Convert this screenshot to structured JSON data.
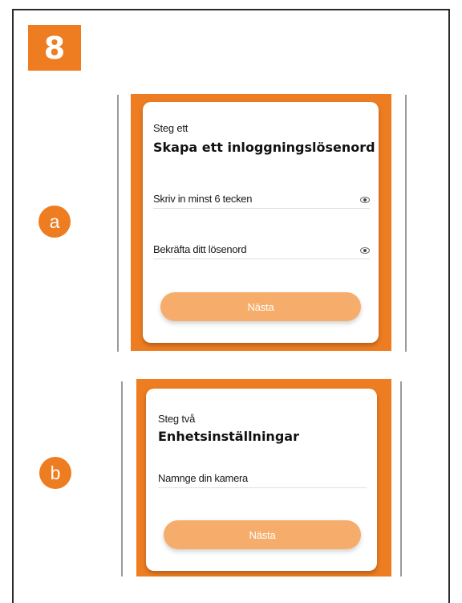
{
  "step_number": "8",
  "panels": [
    {
      "marker": "a",
      "step_label": "Steg ett",
      "title": "Skapa ett inloggningslösenord",
      "fields": [
        {
          "label": "Skriv in minst 6 tecken",
          "icon": "eye-icon"
        },
        {
          "label": "Bekräfta ditt lösenord",
          "icon": "eye-icon"
        }
      ],
      "button_label": "Nästa"
    },
    {
      "marker": "b",
      "step_label": "Steg två",
      "title": "Enhetsinställningar",
      "fields": [
        {
          "label": "Namnge din kamera"
        }
      ],
      "button_label": "Nästa"
    }
  ],
  "colors": {
    "accent": "#ee7d22",
    "button": "#f6ad6b",
    "card": "#ffffff"
  }
}
